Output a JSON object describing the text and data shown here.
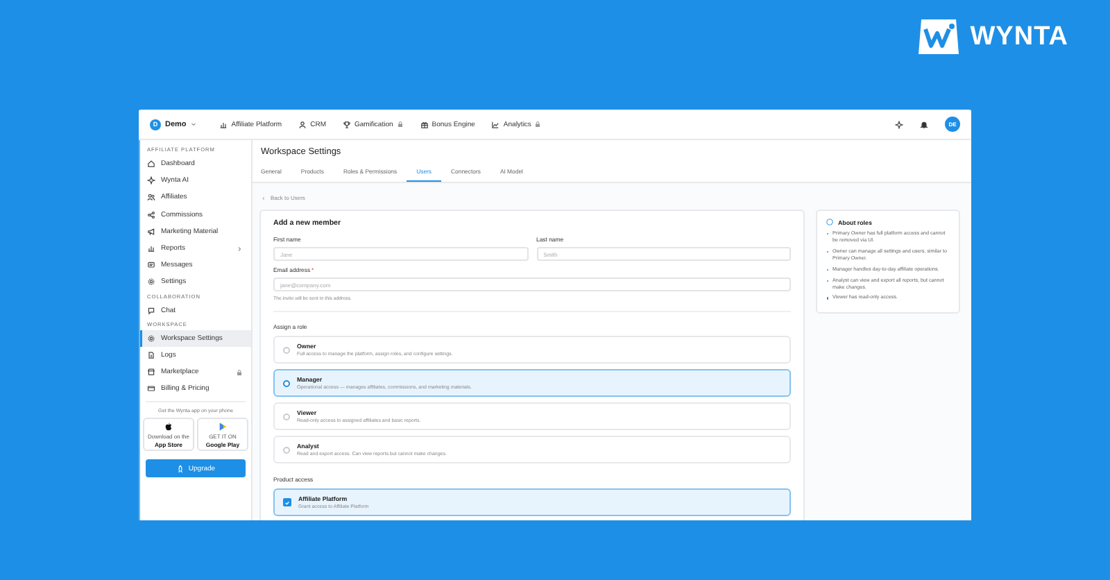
{
  "logo": {
    "text": "WYNTA"
  },
  "topbar": {
    "workspace": {
      "initial": "D",
      "name": "Demo"
    },
    "nav": [
      {
        "label": "Affiliate Platform",
        "locked": false
      },
      {
        "label": "CRM",
        "locked": false
      },
      {
        "label": "Gamification",
        "locked": true
      },
      {
        "label": "Bonus Engine",
        "locked": false
      },
      {
        "label": "Analytics",
        "locked": true
      }
    ],
    "avatar": "DE"
  },
  "sidebar": {
    "sections": [
      {
        "title": "AFFILIATE PLATFORM",
        "items": [
          {
            "label": "Dashboard",
            "selected": false,
            "locked": false,
            "expandable": false
          },
          {
            "label": "Wynta AI",
            "selected": false,
            "locked": false,
            "expandable": false
          },
          {
            "label": "Affiliates",
            "selected": false,
            "locked": false,
            "expandable": false
          },
          {
            "label": "Commissions",
            "selected": false,
            "locked": false,
            "expandable": false
          },
          {
            "label": "Marketing Material",
            "selected": false,
            "locked": false,
            "expandable": false
          },
          {
            "label": "Reports",
            "selected": false,
            "locked": false,
            "expandable": true
          },
          {
            "label": "Messages",
            "selected": false,
            "locked": false,
            "expandable": false
          },
          {
            "label": "Settings",
            "selected": false,
            "locked": false,
            "expandable": false
          }
        ]
      },
      {
        "title": "COLLABORATION",
        "items": [
          {
            "label": "Chat",
            "selected": false,
            "locked": false,
            "expandable": false
          }
        ]
      },
      {
        "title": "WORKSPACE",
        "items": [
          {
            "label": "Workspace Settings",
            "selected": true,
            "locked": false,
            "expandable": false
          },
          {
            "label": "Logs",
            "selected": false,
            "locked": false,
            "expandable": false
          },
          {
            "label": "Marketplace",
            "selected": false,
            "locked": true,
            "expandable": false
          },
          {
            "label": "Billing & Pricing",
            "selected": false,
            "locked": false,
            "expandable": false
          }
        ]
      }
    ],
    "app_promo": {
      "text": "Get the Wynta app on your phone",
      "stores": [
        {
          "kind": "apple",
          "caption": "Download on the",
          "name": "App Store"
        },
        {
          "kind": "google",
          "caption": "GET IT ON",
          "name": "Google Play"
        }
      ]
    },
    "upgrade": "Upgrade"
  },
  "main": {
    "title": "Workspace Settings",
    "tabs": [
      {
        "label": "General",
        "selected": false
      },
      {
        "label": "Products",
        "selected": false
      },
      {
        "label": "Roles & Permissions",
        "selected": false
      },
      {
        "label": "Users",
        "selected": true
      },
      {
        "label": "Connectors",
        "selected": false
      },
      {
        "label": "AI Model",
        "selected": false
      }
    ],
    "back": "Back to Users",
    "form": {
      "title": "Add a new member",
      "first_name": {
        "label": "First name",
        "placeholder": "Jane"
      },
      "last_name": {
        "label": "Last name",
        "placeholder": "Smith"
      },
      "email": {
        "label": "Email address",
        "required_mark": "*",
        "placeholder": "jane@company.com",
        "hint": "The invite will be sent to this address."
      },
      "roles_label": "Assign a role",
      "roles": [
        {
          "name": "Owner",
          "description": "Full access to manage the platform, assign roles, and configure settings.",
          "selected": false
        },
        {
          "name": "Manager",
          "description": "Operational access — manages affiliates, commissions, and marketing materials.",
          "selected": true
        },
        {
          "name": "Viewer",
          "description": "Read-only access to assigned affiliates and basic reports.",
          "selected": false
        },
        {
          "name": "Analyst",
          "description": "Read and export access. Can view reports but cannot make changes.",
          "selected": false
        }
      ],
      "products_label": "Product access",
      "products": [
        {
          "name": "Affiliate Platform",
          "description": "Grant access to Affiliate Platform",
          "checked": true
        }
      ]
    }
  },
  "about": {
    "title": "About roles",
    "items": [
      "Primary Owner has full platform access and cannot be removed via UI.",
      "Owner can manage all settings and users, similar to Primary Owner.",
      "Manager handles day-to-day affiliate operations.",
      "Analyst can view and export all reports, but cannot make changes.",
      "Viewer has read-only access."
    ]
  }
}
